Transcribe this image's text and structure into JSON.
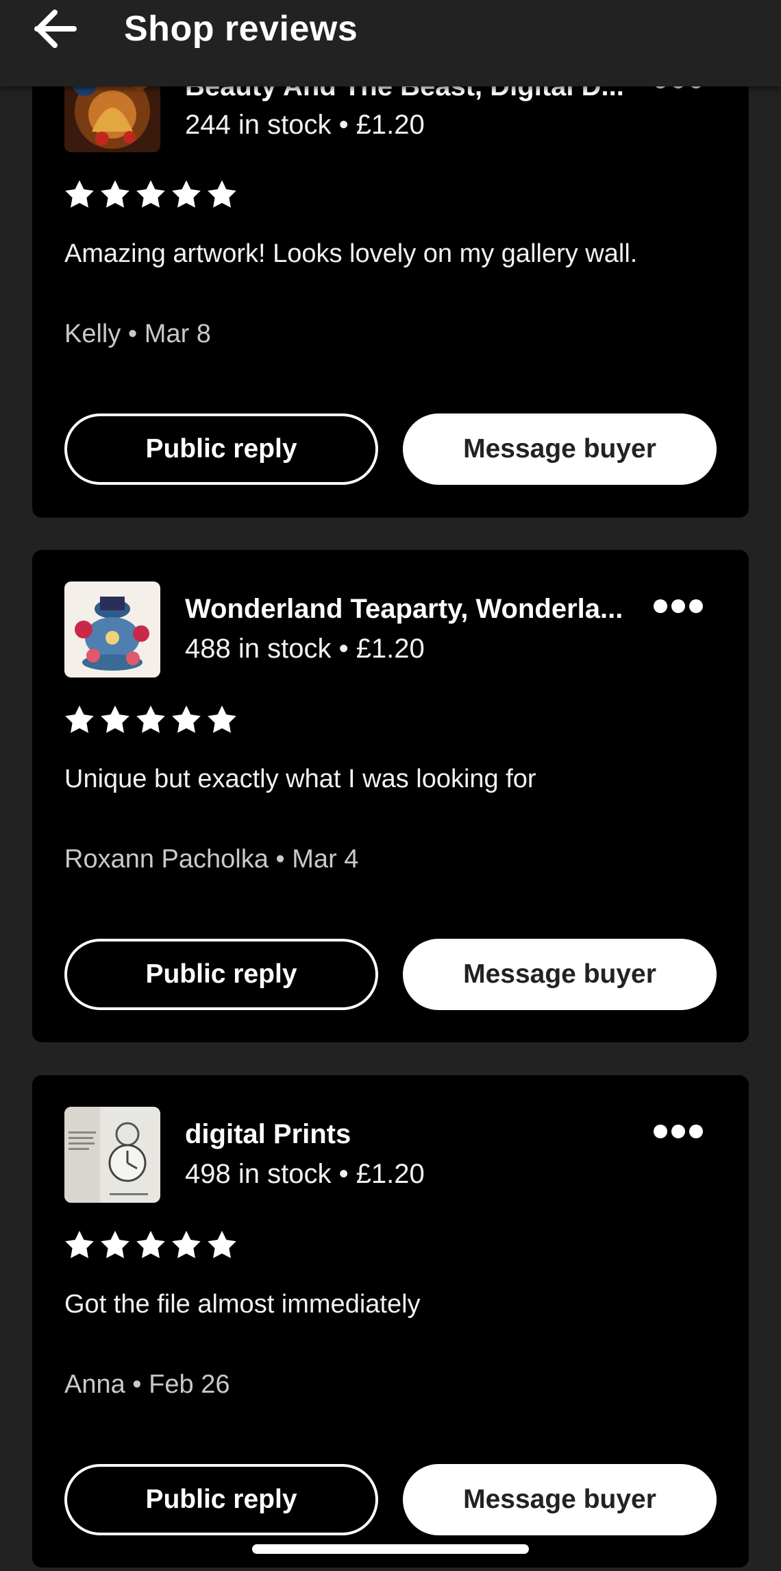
{
  "header": {
    "title": "Shop reviews",
    "back_icon": "arrow-left-icon"
  },
  "reviews": [
    {
      "product_title": "Beauty And The Beast, Digital D...",
      "stock_price": "244 in stock • £1.20",
      "rating": 5,
      "text": "Amazing artwork! Looks lovely on my gallery wall.",
      "meta": "Kelly • Mar 8",
      "public_reply_label": "Public reply",
      "message_buyer_label": "Message buyer"
    },
    {
      "product_title": "Wonderland Teaparty, Wonderla...",
      "stock_price": "488 in stock • £1.20",
      "rating": 5,
      "text": "Unique but exactly what I was looking for",
      "meta": "Roxann Pacholka • Mar 4",
      "public_reply_label": "Public reply",
      "message_buyer_label": "Message buyer"
    },
    {
      "product_title": "digital Prints",
      "stock_price": "498 in stock • £1.20",
      "rating": 5,
      "text": "Got the file almost immediately",
      "meta": "Anna • Feb 26",
      "public_reply_label": "Public reply",
      "message_buyer_label": "Message buyer"
    }
  ],
  "colors": {
    "background": "#222222",
    "card": "#000000",
    "text": "#ffffff",
    "muted_text": "#c9c9c9"
  }
}
